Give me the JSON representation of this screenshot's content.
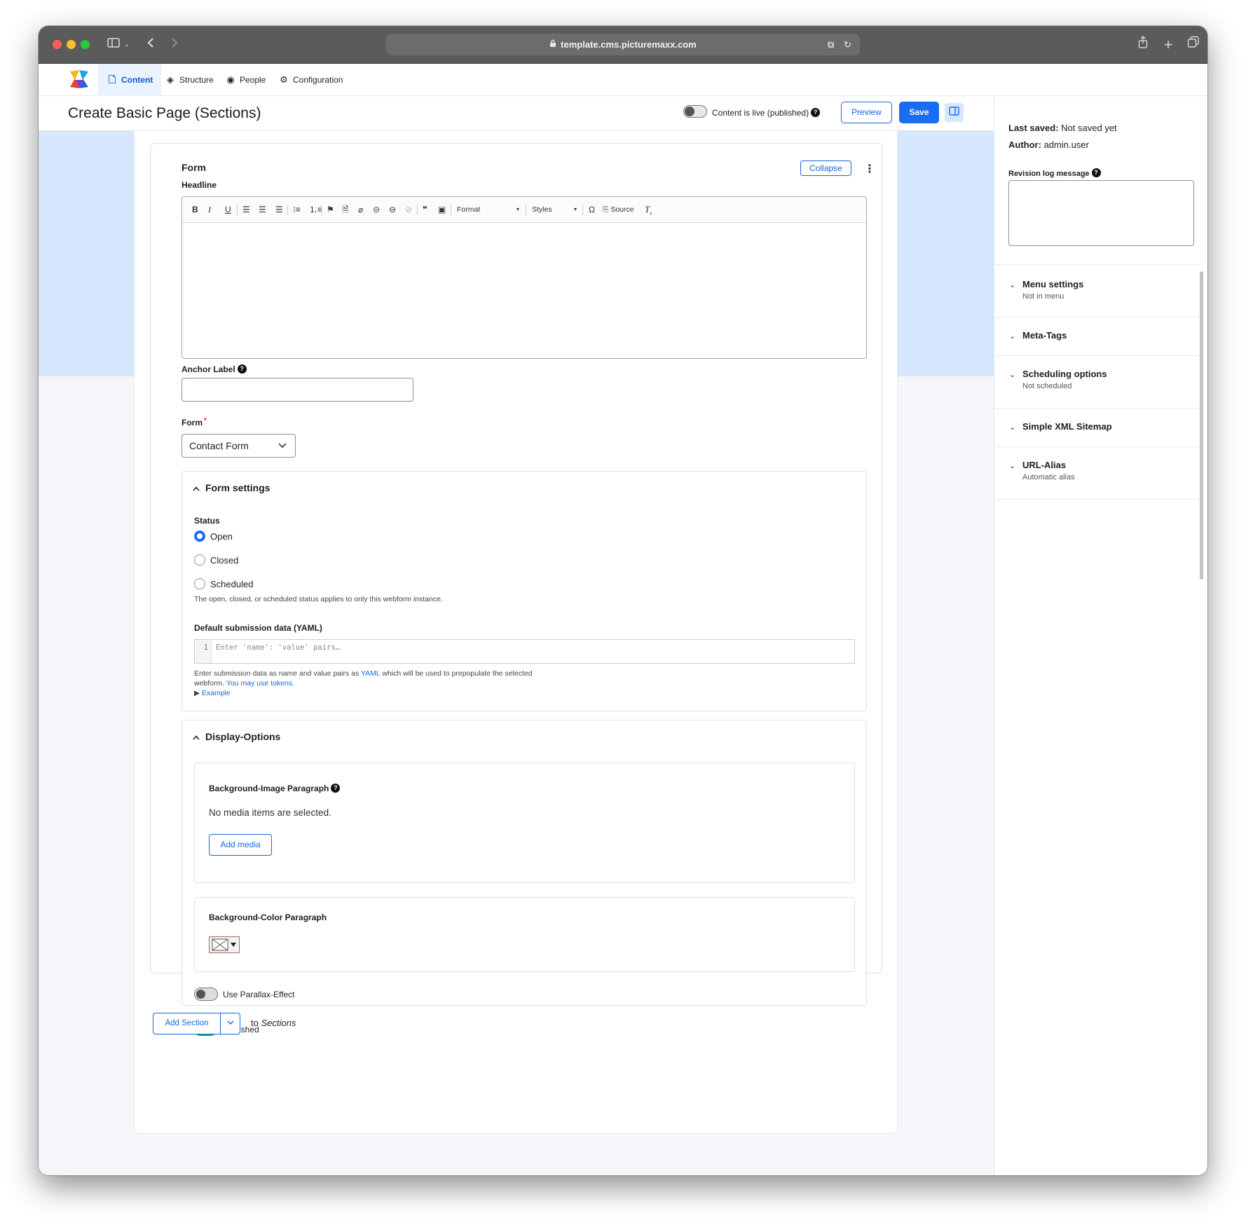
{
  "browser": {
    "url": "template.cms.picturemaxx.com"
  },
  "nav": {
    "items": [
      {
        "label": "Content",
        "icon": "file-icon",
        "active": true
      },
      {
        "label": "Structure",
        "icon": "layers-icon",
        "active": false
      },
      {
        "label": "People",
        "icon": "user-circle-icon",
        "active": false
      },
      {
        "label": "Configuration",
        "icon": "gear-icon",
        "active": false
      }
    ]
  },
  "header": {
    "title": "Create Basic Page (Sections)",
    "live_label": "Content is live (published)",
    "preview_label": "Preview",
    "save_label": "Save"
  },
  "form": {
    "title": "Form",
    "collapse_label": "Collapse",
    "headline_label": "Headline",
    "toolbar": {
      "format_label": "Format",
      "styles_label": "Styles",
      "source_label": "Source"
    },
    "anchor_label": "Anchor Label",
    "anchor_value": "",
    "form_label": "Form",
    "form_selected": "Contact Form"
  },
  "form_settings": {
    "legend": "Form settings",
    "status_label": "Status",
    "status_options": [
      {
        "label": "Open",
        "selected": true
      },
      {
        "label": "Closed",
        "selected": false
      },
      {
        "label": "Scheduled",
        "selected": false
      }
    ],
    "status_help": "The open, closed, or scheduled status applies to only this webform instance.",
    "yaml_label": "Default submission data (YAML)",
    "yaml_line": "1",
    "yaml_placeholder": "Enter 'name': 'value' pairs…",
    "yaml_help_1": "Enter submission data as name and value pairs as",
    "yaml_help_link": "YAML",
    "yaml_help_2": "which will be used to prepopulate the selected",
    "yaml_help_3": "webform.",
    "yaml_help_tokens": "You may use tokens.",
    "example_label": "Example"
  },
  "display_options": {
    "legend": "Display-Options",
    "bg_image_label": "Background-Image Paragraph",
    "no_media": "No media items are selected.",
    "add_media_label": "Add media",
    "bg_color_label": "Background-Color Paragraph",
    "parallax_label": "Use Parallax-Effect",
    "parallax_on": false,
    "published_label": "Published",
    "published_on": true
  },
  "add_section": {
    "label": "Add Section",
    "to_text": "to",
    "target": "Sections"
  },
  "sidebar": {
    "last_saved_key": "Last saved:",
    "last_saved_value": "Not saved yet",
    "author_key": "Author:",
    "author_value": "admin.user",
    "revision_label": "Revision log message",
    "sections": [
      {
        "title": "Menu settings",
        "summary": "Not in menu"
      },
      {
        "title": "Meta-Tags",
        "summary": ""
      },
      {
        "title": "Scheduling options",
        "summary": "Not scheduled"
      },
      {
        "title": "Simple XML Sitemap",
        "summary": ""
      },
      {
        "title": "URL-Alias",
        "summary": "Automatic alias"
      }
    ]
  },
  "colors": {
    "accent": "#1a6df2",
    "link": "#1368de",
    "toggle_on": "#1c9f4f",
    "band": "#d6e6fd"
  }
}
